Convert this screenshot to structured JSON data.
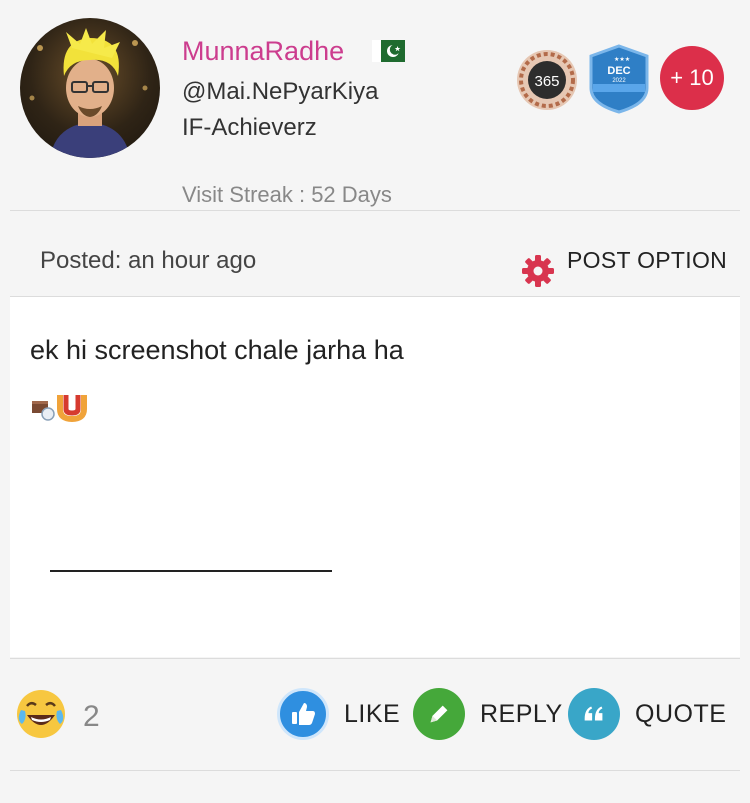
{
  "user": {
    "name": "MunnaRadhe",
    "handle": "@Mai.NePyarKiya",
    "group": "IF-Achieverz",
    "visit_streak": "Visit Streak : 52 Days",
    "flag_icon": "pakistan-flag-icon"
  },
  "badges": {
    "days_badge": "365",
    "month_badge_top": "DEC",
    "month_badge_year": "2022",
    "more_count": "+ 10"
  },
  "post": {
    "posted": "Posted: an hour ago",
    "option_label": "POST OPTION",
    "text": "ek hi screenshot chale jarha ha",
    "signature_line": "___________________________"
  },
  "reactions": {
    "emoji": "laughing-tears-emoji",
    "count": "2"
  },
  "actions": {
    "like": "LIKE",
    "reply": "REPLY",
    "quote": "QUOTE"
  },
  "colors": {
    "username": "#cc3d8e",
    "more_badge": "#dc2f4a",
    "gear": "#d8354f",
    "like": "#2f8fe0",
    "reply": "#45a83a",
    "quote": "#39a6c8"
  }
}
